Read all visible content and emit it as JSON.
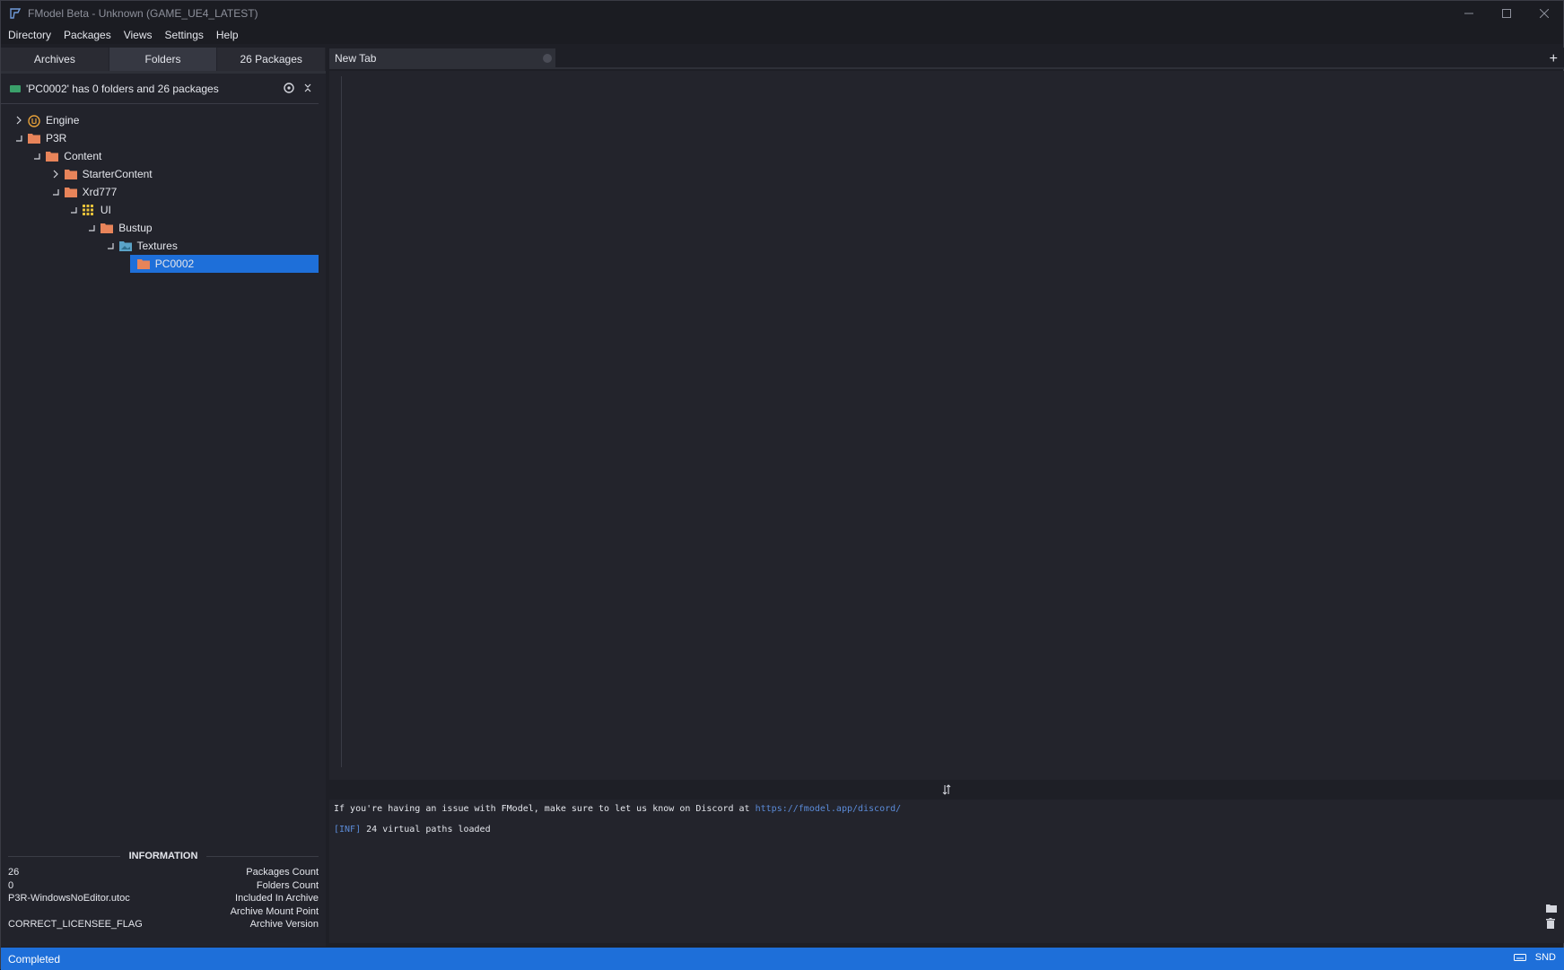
{
  "window": {
    "title": "FModel Beta - Unknown (GAME_UE4_LATEST)"
  },
  "menu": [
    "Directory",
    "Packages",
    "Views",
    "Settings",
    "Help"
  ],
  "left_tabs": [
    "Archives",
    "Folders",
    "26 Packages"
  ],
  "active_left_tab": "Folders",
  "path_label": "'PC0002' has 0 folders and 26 packages",
  "tree": [
    {
      "name": "Engine",
      "indent": 0,
      "icon": "unreal-engine-icon",
      "arrow": "collapsed"
    },
    {
      "name": "P3R",
      "indent": 0,
      "icon": "folder-icon",
      "arrow": "expanded"
    },
    {
      "name": "Content",
      "indent": 1,
      "icon": "folder-icon",
      "arrow": "expanded"
    },
    {
      "name": "StarterContent",
      "indent": 2,
      "icon": "folder-icon",
      "arrow": "collapsed"
    },
    {
      "name": "Xrd777",
      "indent": 2,
      "icon": "folder-icon",
      "arrow": "expanded"
    },
    {
      "name": "UI",
      "indent": 3,
      "icon": "grid-icon",
      "arrow": "expanded"
    },
    {
      "name": "Bustup",
      "indent": 4,
      "icon": "folder-icon",
      "arrow": "expanded"
    },
    {
      "name": "Textures",
      "indent": 5,
      "icon": "texture-folder-icon",
      "arrow": "expanded"
    },
    {
      "name": "PC0002",
      "indent": 6,
      "icon": "folder-icon",
      "arrow": "none",
      "selected": true
    }
  ],
  "info": {
    "heading": "INFORMATION",
    "rows": [
      {
        "value": "26",
        "label": "Packages Count"
      },
      {
        "value": "0",
        "label": "Folders Count"
      },
      {
        "value": "P3R-WindowsNoEditor.utoc",
        "label": "Included In Archive"
      },
      {
        "value": "",
        "label": "Archive Mount Point"
      },
      {
        "value": "CORRECT_LICENSEE_FLAG",
        "label": "Archive Version"
      }
    ]
  },
  "editor": {
    "tab_label": "New Tab",
    "add_tab": "+"
  },
  "console": {
    "line1_text": "If you're having an issue with FModel, make sure to let us know on Discord at ",
    "line1_link": "https://fmodel.app/discord/",
    "line2_tag": "[INF]",
    "line2_text": " 24 virtual paths loaded"
  },
  "status": {
    "text": "Completed",
    "right_label": "SND"
  },
  "colors": {
    "accent": "#1e6fd9",
    "folder": "#e8845a",
    "link": "#5b8bd8"
  }
}
